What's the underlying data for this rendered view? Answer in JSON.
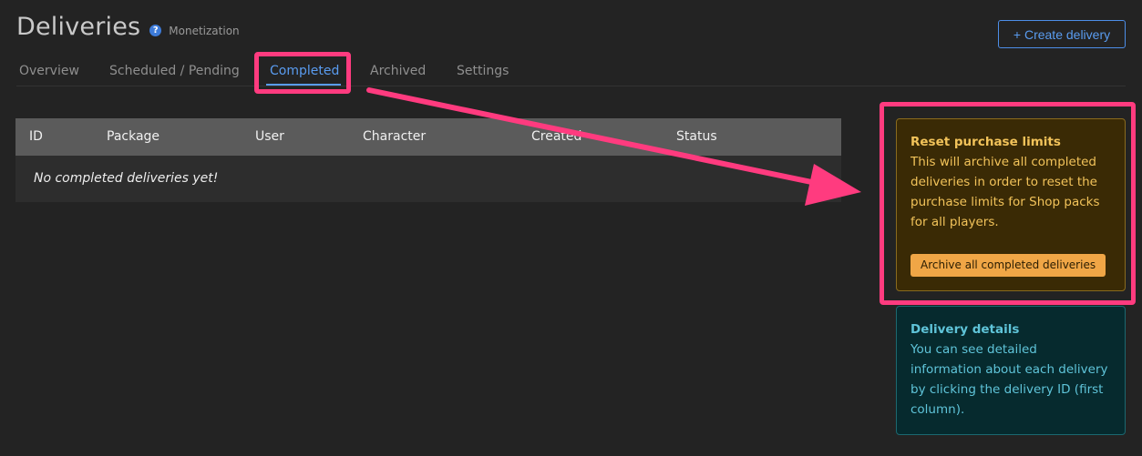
{
  "header": {
    "title": "Deliveries",
    "help_icon": "question-circle-icon",
    "subtitle": "Monetization",
    "create_button": "+ Create delivery"
  },
  "tabs": [
    {
      "label": "Overview",
      "active": false
    },
    {
      "label": "Scheduled / Pending",
      "active": false
    },
    {
      "label": "Completed",
      "active": true
    },
    {
      "label": "Archived",
      "active": false
    },
    {
      "label": "Settings",
      "active": false
    }
  ],
  "table": {
    "columns": [
      "ID",
      "Package",
      "User",
      "Character",
      "Created",
      "Status"
    ],
    "empty_message": "No completed deliveries yet!"
  },
  "reset_card": {
    "title": "Reset purchase limits",
    "body": "This will archive all completed deliveries in order to reset the purchase limits for Shop packs for all players.",
    "button": "Archive all completed deliveries"
  },
  "details_card": {
    "title": "Delivery details",
    "body": "You can see detailed information about each delivery by clicking the delivery ID (first column)."
  },
  "colors": {
    "accent": "#5a9cf0",
    "highlight": "#ff3b7f",
    "warning_bg": "#3a2a05",
    "warning_text": "#f2c35a",
    "info_bg": "#062a2e",
    "info_text": "#5fc4d9"
  }
}
